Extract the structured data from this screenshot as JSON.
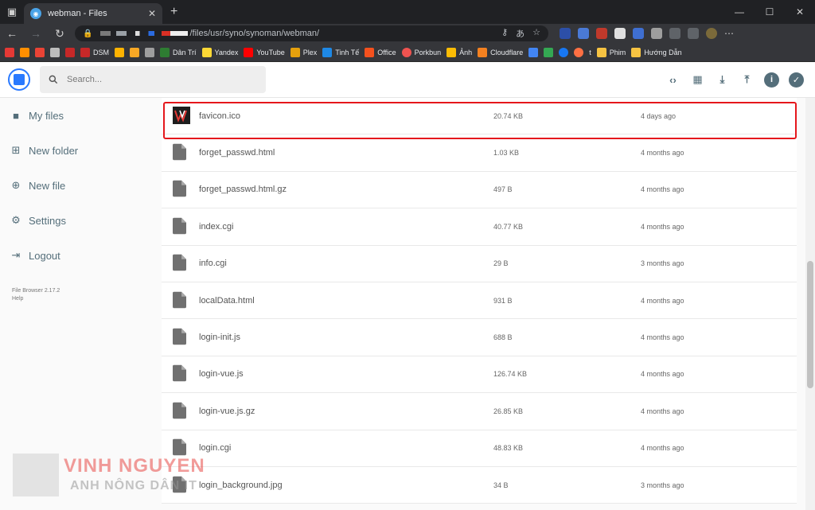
{
  "browser": {
    "tab_title": "webman - Files",
    "tab_close": "✕",
    "new_tab": "+",
    "url_path": "/files/usr/syno/synoman/webman/",
    "bookmarks": [
      "DSM",
      "Dân Trí",
      "Yandex",
      "YouTube",
      "Plex",
      "Tinh Tế",
      "Office",
      "Porkbun",
      "Ảnh",
      "Cloudflare",
      "t",
      "Phim",
      "Hướng Dẫn"
    ]
  },
  "header": {
    "search_placeholder": "Search..."
  },
  "sidebar": {
    "items": [
      {
        "label": "My files"
      },
      {
        "label": "New folder"
      },
      {
        "label": "New file"
      },
      {
        "label": "Settings"
      },
      {
        "label": "Logout"
      }
    ],
    "version": "File Browser 2.17.2",
    "help": "Help"
  },
  "files": [
    {
      "name": "favicon.ico",
      "size": "20.74 KB",
      "modified": "4 days ago"
    },
    {
      "name": "forget_passwd.html",
      "size": "1.03 KB",
      "modified": "4 months ago"
    },
    {
      "name": "forget_passwd.html.gz",
      "size": "497 B",
      "modified": "4 months ago"
    },
    {
      "name": "index.cgi",
      "size": "40.77 KB",
      "modified": "4 months ago"
    },
    {
      "name": "info.cgi",
      "size": "29 B",
      "modified": "3 months ago"
    },
    {
      "name": "localData.html",
      "size": "931 B",
      "modified": "4 months ago"
    },
    {
      "name": "login-init.js",
      "size": "688 B",
      "modified": "4 months ago"
    },
    {
      "name": "login-vue.js",
      "size": "126.74 KB",
      "modified": "4 months ago"
    },
    {
      "name": "login-vue.js.gz",
      "size": "26.85 KB",
      "modified": "4 months ago"
    },
    {
      "name": "login.cgi",
      "size": "48.83 KB",
      "modified": "4 months ago"
    },
    {
      "name": "login_background.jpg",
      "size": "34 B",
      "modified": "3 months ago"
    }
  ],
  "watermark": {
    "name": "VINH NGUYEN",
    "subtitle": "ANH NÔNG DÂN IT"
  },
  "colors": {
    "accent": "#2979ff",
    "highlight": "#e5171c",
    "icon": "#546e7a"
  }
}
